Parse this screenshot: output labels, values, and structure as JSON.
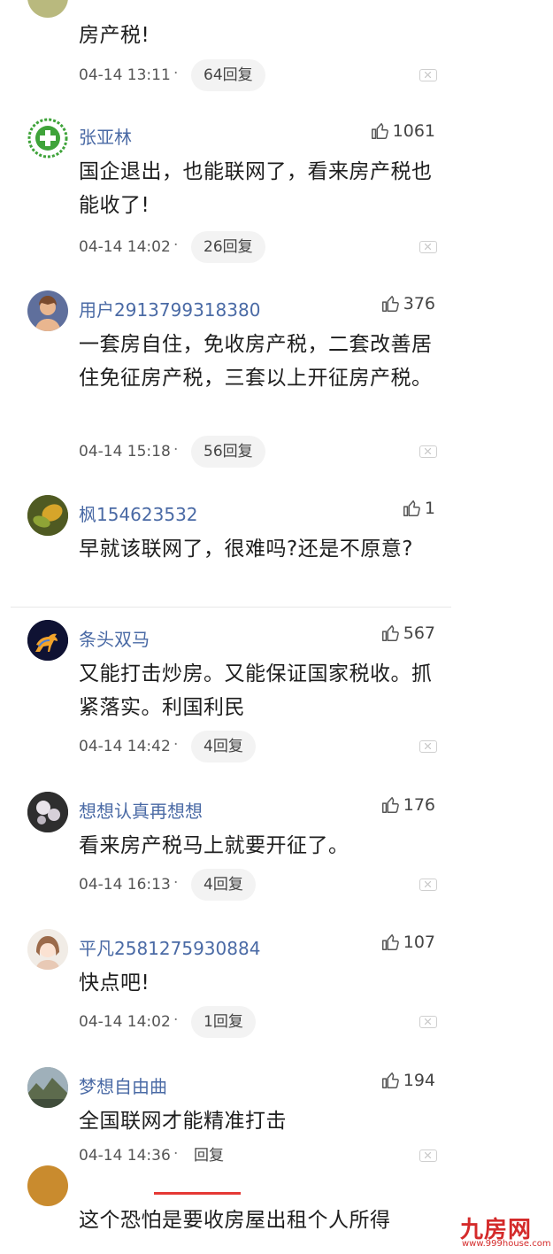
{
  "comments": [
    {
      "username": "",
      "likes": "",
      "content": "房产税!",
      "time": "04-14 13:11",
      "separator": "·",
      "replies": "64回复",
      "avatar": "olive-avatar"
    },
    {
      "username": "张亚林",
      "likes": "1061",
      "content": "国企退出，也能联网了，看来房产税也能收了!",
      "time": "04-14 14:02",
      "separator": "·",
      "replies": "26回复",
      "avatar": "green-cross-avatar"
    },
    {
      "username": "用户2913799318380",
      "likes": "376",
      "content": "一套房自住，免收房产税，二套改善居住免征房产税，三套以上开征房产税。",
      "time": "04-14 15:18",
      "separator": "·",
      "replies": "56回复",
      "avatar": "default-user-avatar"
    },
    {
      "username": "枫154623532",
      "likes": "1",
      "content": "早就该联网了，很难吗?还是不原意?",
      "avatar": "leaf-avatar"
    },
    {
      "username": "条头双马",
      "likes": "567",
      "content": "又能打击炒房。又能保证国家税收。抓紧落实。利国利民",
      "time": "04-14 14:42",
      "separator": "·",
      "replies": "4回复",
      "avatar": "horse-avatar"
    },
    {
      "username": "想想认真再想想",
      "likes": "176",
      "content": "看来房产税马上就要开征了。",
      "time": "04-14 16:13",
      "separator": "·",
      "replies": "4回复",
      "avatar": "flower-avatar"
    },
    {
      "username": "平凡2581275930884",
      "likes": "107",
      "content": "快点吧!",
      "time": "04-14 14:02",
      "separator": "·",
      "replies": "1回复",
      "avatar": "cartoon-girl-avatar"
    },
    {
      "username": "梦想自由曲",
      "likes": "194",
      "content": "全国联网才能精准打击",
      "time": "04-14 14:36",
      "separator": "·",
      "replies": "回复",
      "avatar": "landscape-avatar"
    },
    {
      "content": "这个恐怕是要收房屋出租个人所得",
      "avatar": "partial-avatar"
    }
  ],
  "watermark": {
    "logo": "九房网",
    "url": "www.999house.com"
  },
  "colors": {
    "username": "#4a6aa5",
    "indicator": "#e53935",
    "watermark": "#d42a2a"
  }
}
